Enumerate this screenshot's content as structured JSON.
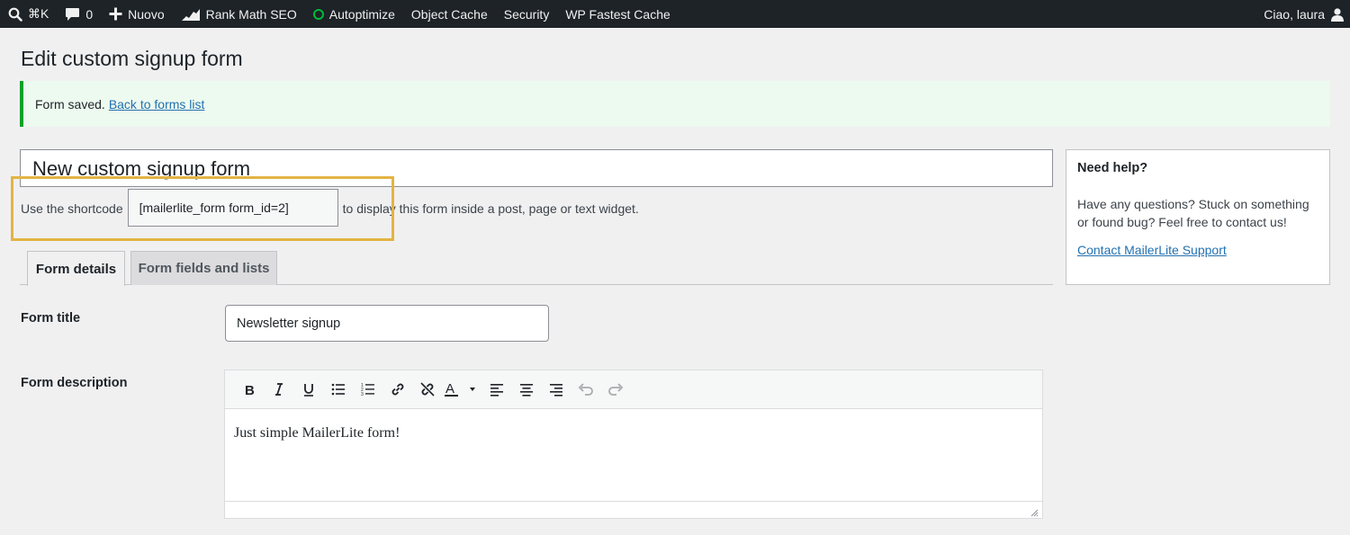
{
  "admin_bar": {
    "search_shortcut": "⌘K",
    "comments_count": "0",
    "new_label": "Nuovo",
    "rank_math_label": "Rank Math SEO",
    "autoptimize_label": "Autoptimize",
    "object_cache_label": "Object Cache",
    "security_label": "Security",
    "wp_fastest_cache_label": "WP Fastest Cache",
    "greeting": "Ciao, laura"
  },
  "page": {
    "title": "Edit custom signup form"
  },
  "notice": {
    "text": "Form saved.",
    "link": "Back to forms list"
  },
  "form": {
    "name_value": "New custom signup form",
    "shortcode_label": "Use the shortcode",
    "shortcode_value": "[mailerlite_form form_id=2]",
    "shortcode_after": "to display this form inside a post, page or text widget."
  },
  "tabs": [
    {
      "label": "Form details",
      "active": true
    },
    {
      "label": "Form fields and lists",
      "active": false
    }
  ],
  "fields": {
    "title_label": "Form title",
    "title_value": "Newsletter signup",
    "description_label": "Form description",
    "description_value": "Just simple MailerLite form!"
  },
  "help": {
    "title": "Need help?",
    "text": "Have any questions? Stuck on something or found bug? Feel free to contact us!",
    "link": "Contact MailerLite Support"
  },
  "colors": {
    "admin_bar_bg": "#1d2327",
    "notice_border": "#00a32a",
    "highlight_border": "#e3b443",
    "link": "#2271b1"
  }
}
